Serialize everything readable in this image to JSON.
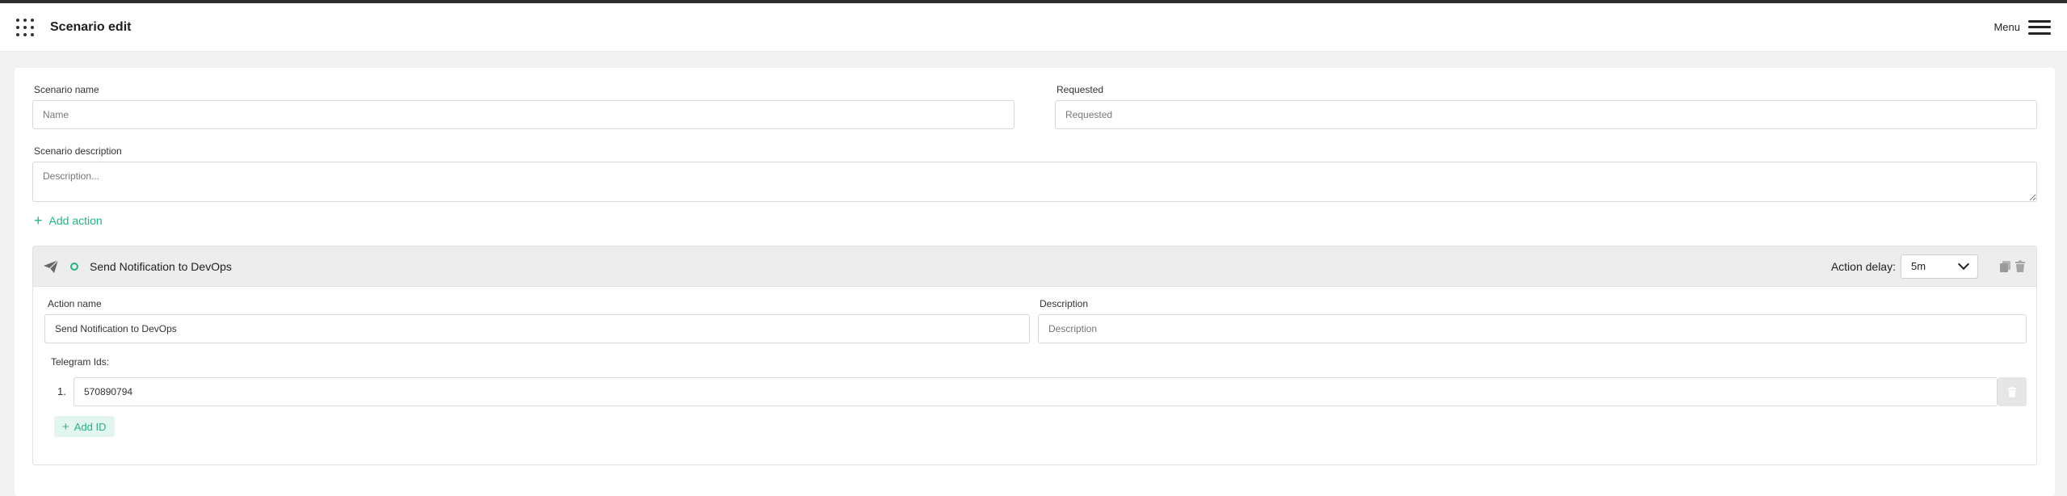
{
  "header": {
    "title": "Scenario edit",
    "menu_label": "Menu"
  },
  "form": {
    "scenario_name_label": "Scenario name",
    "scenario_name_placeholder": "Name",
    "requested_label": "Requested",
    "requested_placeholder": "Requested",
    "description_label": "Scenario description",
    "description_placeholder": "Description...",
    "add_action_label": "Add action"
  },
  "action": {
    "title": "Send Notification to DevOps",
    "icon": "paper-plane-icon",
    "delay_label": "Action delay:",
    "delay_value": "5m",
    "name_label": "Action name",
    "name_value": "Send Notification to DevOps",
    "description_label": "Description",
    "description_placeholder": "Description",
    "telegram_label": "Telegram Ids:",
    "telegram_ids": [
      {
        "index": "1.",
        "value": "570890794"
      }
    ],
    "add_id_label": "Add ID"
  },
  "colors": {
    "accent": "#1fb584",
    "top_strip": "#2e2e2e"
  }
}
